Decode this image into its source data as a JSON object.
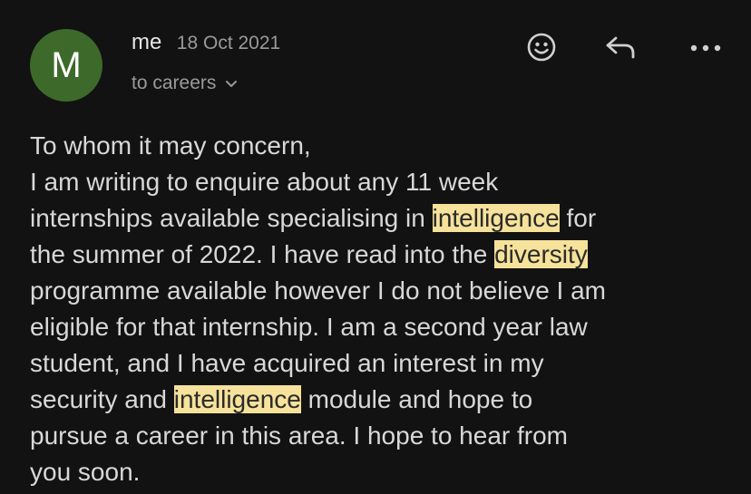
{
  "header": {
    "avatar_initial": "M",
    "sender": "me",
    "date": "18 Oct 2021",
    "recipient": "to careers",
    "avatar_color": "#3d6a2a"
  },
  "actions": [
    {
      "name": "emoji-react",
      "icon": "smiley-icon"
    },
    {
      "name": "reply",
      "icon": "reply-arrow-icon"
    },
    {
      "name": "more",
      "icon": "ellipsis-icon"
    }
  ],
  "highlight_color": "#f6e29a",
  "body": {
    "l1": "To whom it may concern,",
    "l2": "I am writing to enquire about any 11 week",
    "l3a": "internships available specialising in ",
    "l3b": "intelligence",
    "l3c": " for",
    "l4a": "the summer of 2022. I have read into the ",
    "l4b": "diversity",
    "l5": "programme available however I do not believe I am",
    "l6": "eligible for that internship. I am a second year law",
    "l7": "student, and I have acquired an interest in my",
    "l8a": "security and ",
    "l8b": "intelligence",
    "l8c": " module and hope to",
    "l9": "pursue a career in this area. I hope to hear from",
    "l10": "you soon."
  }
}
